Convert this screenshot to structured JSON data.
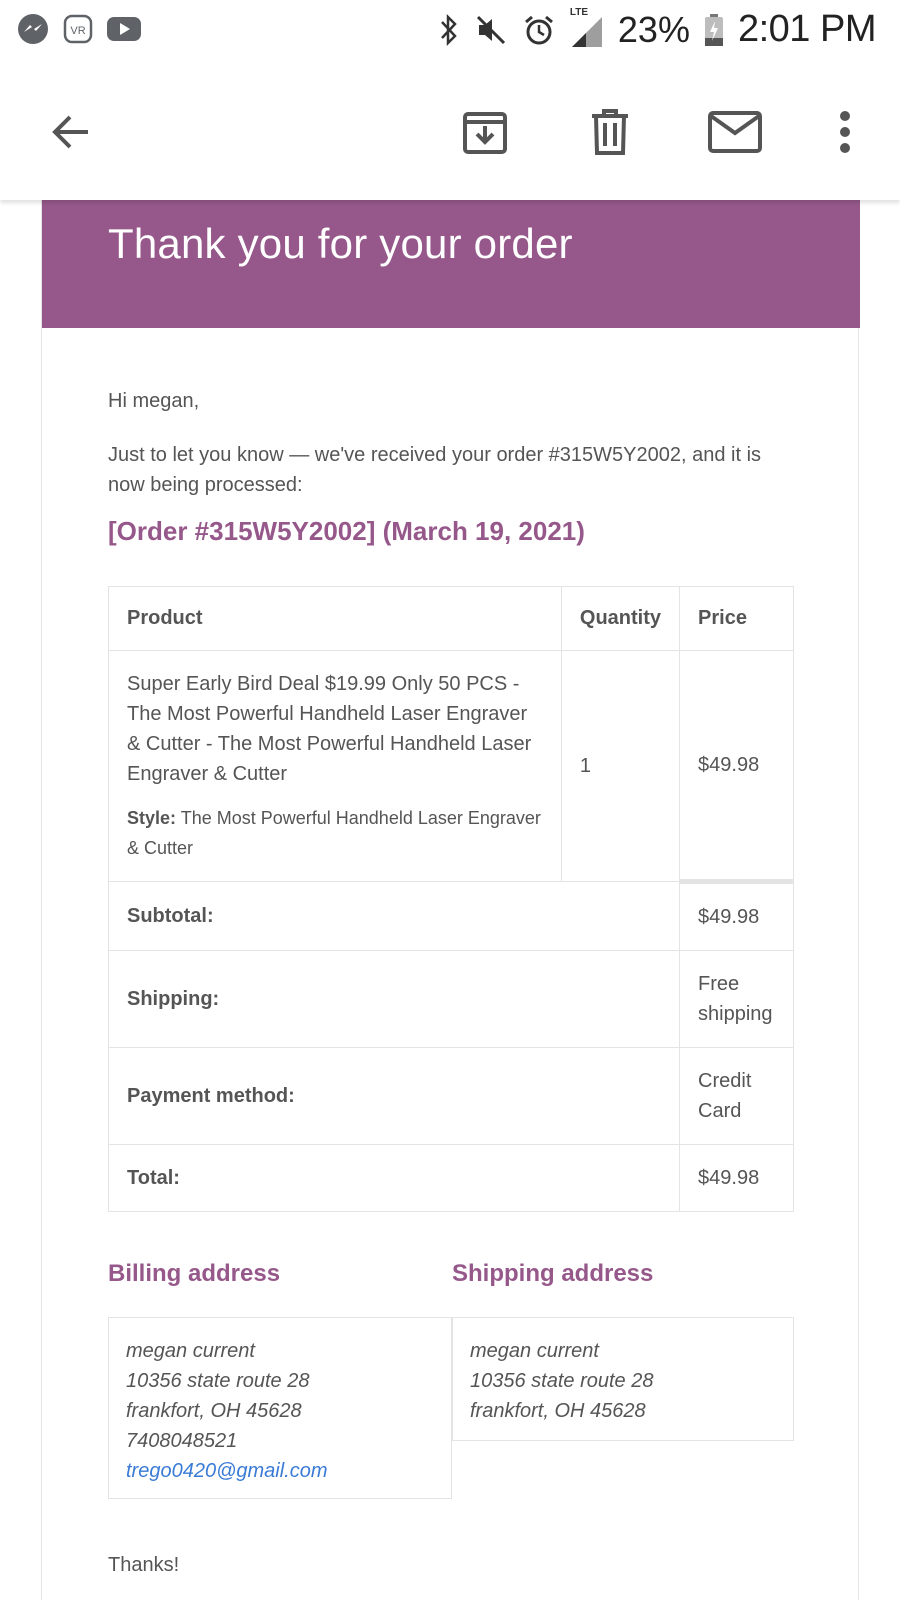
{
  "status_bar": {
    "left_icons": [
      "messenger-icon",
      "vr-icon",
      "youtube-icon"
    ],
    "right_icons": [
      "bluetooth-icon",
      "mute-icon",
      "alarm-icon",
      "signal-lte-icon"
    ],
    "network_label": "LTE",
    "battery_percent": "23%",
    "time": "2:01 PM"
  },
  "app_bar": {
    "icons": [
      "back-arrow-icon",
      "archive-icon",
      "delete-icon",
      "mark-unread-icon",
      "more-vert-icon"
    ]
  },
  "email": {
    "banner_title": "Thank you for your order",
    "greeting": "Hi megan,",
    "intro": "Just to let you know — we've received your order #315W5Y2002, and it is now being processed:",
    "order_heading": "[Order #315W5Y2002] (March 19, 2021)",
    "table": {
      "headers": {
        "product": "Product",
        "quantity": "Quantity",
        "price": "Price"
      },
      "item": {
        "name": "Super Early Bird Deal $19.99 Only 50 PCS - The Most Powerful Handheld Laser Engraver & Cutter - The Most Powerful Handheld Laser Engraver & Cutter",
        "meta_label": "Style:",
        "meta_value": "The Most Powerful Handheld Laser Engraver & Cutter",
        "quantity": "1",
        "price": "$49.98"
      },
      "totals": [
        {
          "label": "Subtotal:",
          "value": "$49.98"
        },
        {
          "label": "Shipping:",
          "value": "Free shipping"
        },
        {
          "label": "Payment method:",
          "value": "Credit Card"
        },
        {
          "label": "Total:",
          "value": "$49.98"
        }
      ]
    },
    "billing": {
      "heading": "Billing address",
      "name": "megan current",
      "street": "10356 state route 28",
      "city": "frankfort, OH 45628",
      "phone": "7408048521",
      "email": "trego0420@gmail.com"
    },
    "shipping": {
      "heading": "Shipping address",
      "name": "megan current",
      "street": "10356 state route 28",
      "city": "frankfort, OH 45628"
    },
    "closing": "Thanks!"
  },
  "colors": {
    "brand_purple": "#96588a",
    "text": "#555555",
    "link": "#3a7bd5"
  }
}
